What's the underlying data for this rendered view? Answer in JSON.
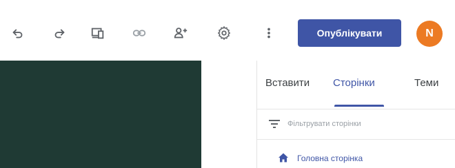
{
  "toolbar": {
    "undo_icon": "undo-icon",
    "redo_icon": "redo-icon",
    "preview_icon": "device-preview-icon",
    "link_icon": "link-icon",
    "share_icon": "add-person-icon",
    "settings_icon": "gear-icon",
    "more_icon": "more-vert-icon",
    "publish_label": "Опублікувати",
    "avatar_initial": "N"
  },
  "colors": {
    "accent": "#3f55a6",
    "avatar": "#ec7a23",
    "canvas": "#1f3a34"
  },
  "panel": {
    "tabs": [
      {
        "label": "Вставити",
        "active": false
      },
      {
        "label": "Сторінки",
        "active": true
      },
      {
        "label": "Теми",
        "active": false
      }
    ],
    "filter": {
      "placeholder": "Фільтрувати сторінки",
      "icon": "filter-icon"
    },
    "pages": [
      {
        "label": "Головна сторінка",
        "icon": "home-icon"
      }
    ]
  }
}
